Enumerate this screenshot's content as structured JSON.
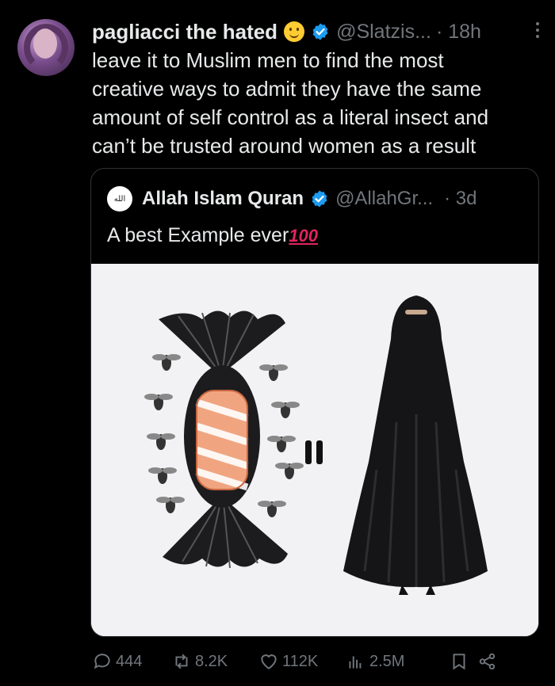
{
  "tweet": {
    "author_name": "pagliacci the hated",
    "handle": "@Slatzis...",
    "time": "· 18h",
    "text_lines": [
      "leave it to Muslim men to find the most",
      "creative ways to admit they have the same",
      "amount of self control as a literal insect and",
      "can’t be trusted around women as a result"
    ]
  },
  "quote": {
    "author_name": "Allah Islam Quran",
    "handle": "@AllahGr...",
    "time": "· 3d",
    "text": "A best Example ever",
    "emoji_text": "100",
    "avatar_glyph": "الله"
  },
  "actions": {
    "replies": "444",
    "reposts": "8.2K",
    "likes": "112K",
    "views": "2.5M"
  },
  "colors": {
    "background": "#000000",
    "text": "#e7e9ea",
    "muted": "#71767b",
    "verified": "#1d9bf0",
    "border": "#2f3336"
  },
  "icons": [
    "more-icon",
    "verified-icon",
    "reply-icon",
    "repost-icon",
    "like-icon",
    "views-icon",
    "bookmark-icon",
    "share-icon"
  ]
}
